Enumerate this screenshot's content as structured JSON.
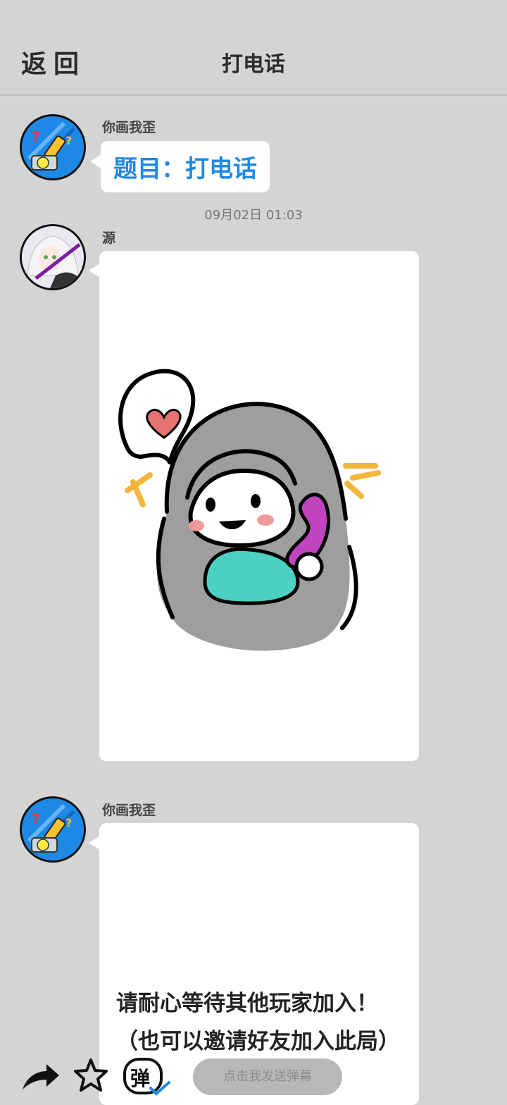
{
  "header": {
    "back_label": "返回",
    "title": "打电话"
  },
  "messages": [
    {
      "sender": "你画我歪",
      "text": "题目：打电话"
    },
    {
      "timestamp": "09月02日  01:03"
    },
    {
      "sender": "源",
      "content": "drawing"
    },
    {
      "sender": "你画我歪",
      "line1": "请耐心等待其他玩家加入！",
      "line2": "（也可以邀请好友加入此局）"
    }
  ],
  "bottom_bar": {
    "danmu_placeholder": "点击我发送弹幕",
    "danmu_icon_char": "弹",
    "icons": [
      "share-arrow-icon",
      "star-icon",
      "danmu-toggle-icon"
    ]
  },
  "colors": {
    "background": "#d4d4d4",
    "accent": "#1e88e5"
  }
}
